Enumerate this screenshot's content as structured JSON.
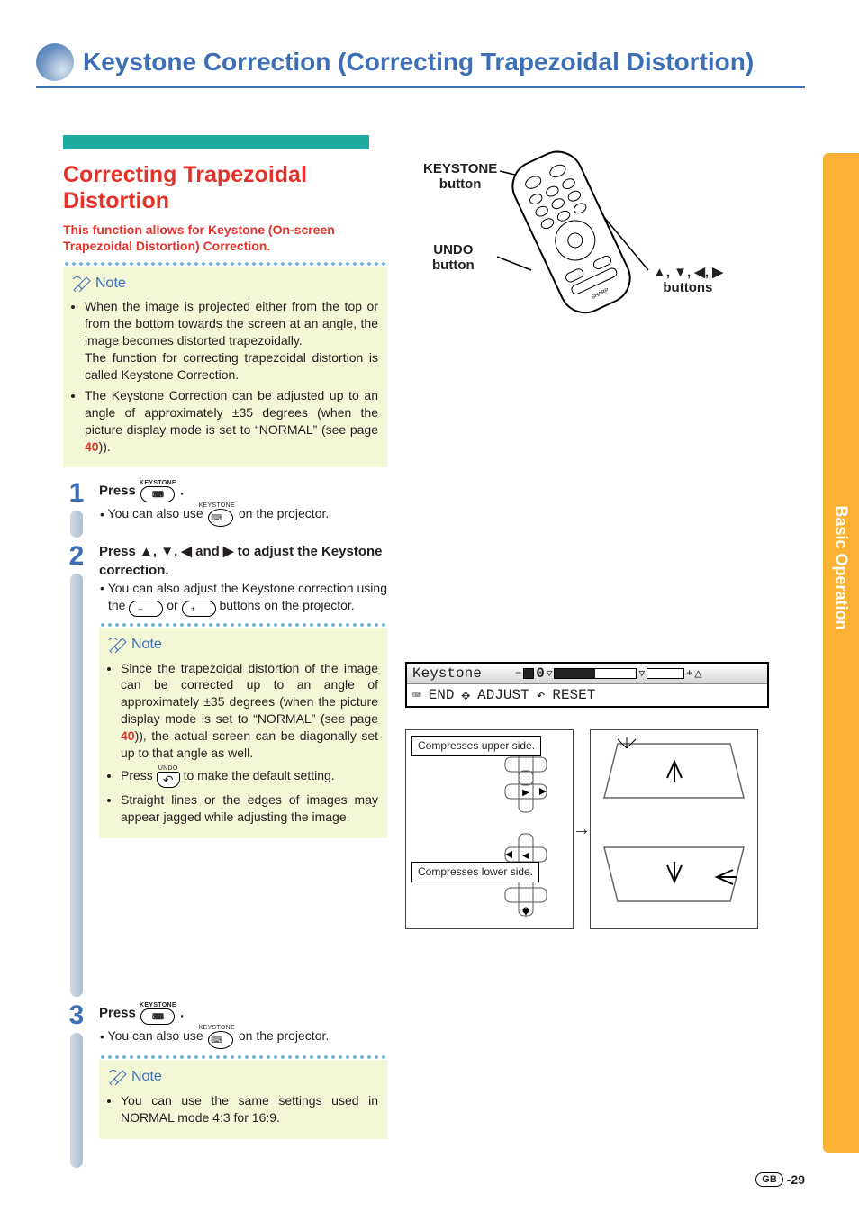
{
  "page_title": "Keystone Correction (Correcting Trapezoidal Distortion)",
  "side_tab": "Basic Operation",
  "section": {
    "heading": "Correcting Trapezoidal Distortion",
    "intro": "This function allows for Keystone (On-screen Trapezoidal Distortion) Correction."
  },
  "note_label": "Note",
  "notes_top": [
    "When the image is projected either from the top or from the bottom towards the screen at an angle, the image becomes distorted trapezoidally.\nThe function for correcting trapezoidal distortion is called Keystone Correction.",
    "The Keystone Correction can be adjusted up to an angle of approximately ±35 degrees (when the picture display mode is set to “NORMAL” (see page 40))."
  ],
  "page_ref": "40",
  "steps": {
    "s1": {
      "num": "1",
      "title_a": "Press",
      "btn_top": "KEYSTONE",
      "title_b": ".",
      "sub_a": "You can also use",
      "sub_b": "on the projector."
    },
    "s2": {
      "num": "2",
      "title": "Press ▲, ▼, ◀ and ▶ to adjust the Keystone correction.",
      "sub_a": "You can also adjust the Keystone correction using the",
      "minus": "–",
      "or": "or",
      "plus": "+",
      "sub_b": "buttons on the projector.",
      "notes": [
        "Since the trapezoidal distortion of the image can be corrected up to an angle of approximately ±35 degrees (when the picture display mode is set to “NORMAL” (see page 40)), the actual screen can be diagonally set up to that angle as well.",
        "Press",
        "to make the default setting.",
        "Straight lines or the edges of images may appear jagged while adjusting the image."
      ],
      "undo_top": "UNDO"
    },
    "s3": {
      "num": "3",
      "title_a": "Press",
      "btn_top": "KEYSTONE",
      "title_b": ".",
      "sub_a": "You can also use",
      "sub_b": "on the projector.",
      "note": "You can use the same settings used in NORMAL mode 4:3 for 16:9."
    }
  },
  "remote": {
    "keystone": "KEYSTONE button",
    "undo": "UNDO button",
    "arrows": "▲, ▼, ◀, ▶ buttons"
  },
  "osd": {
    "name": "Keystone",
    "value": "0",
    "end": "END",
    "adjust": "ADJUST",
    "reset": "RESET"
  },
  "diagram": {
    "upper": "Compresses upper side.",
    "lower": "Compresses lower side."
  },
  "footer": {
    "region": "GB",
    "page": "-29"
  }
}
